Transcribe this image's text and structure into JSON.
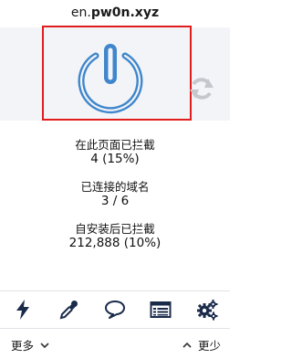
{
  "header": {
    "hostname_prefix": "en.",
    "hostname_domain": "pw0n.xyz"
  },
  "stats": {
    "blocked_on_page_label": "在此页面已拦截",
    "blocked_on_page_value": "4 (15%)",
    "domains_connected_label": "已连接的域名",
    "domains_connected_value": "3 / 6",
    "blocked_since_install_label": "自安装后已拦截",
    "blocked_since_install_value": "212,888 (10%)"
  },
  "toolbar": {
    "tools": [
      "lightning-icon",
      "eyedropper-icon",
      "speech-bubble-icon",
      "logger-icon",
      "gears-icon"
    ]
  },
  "footer": {
    "more_label": "更多",
    "less_label": "更少"
  },
  "colors": {
    "power_blue": "#3f86cc",
    "highlight_red": "#e11d1d",
    "band_bg": "#f3f4f7",
    "refresh_gray": "#c4c7cd"
  }
}
